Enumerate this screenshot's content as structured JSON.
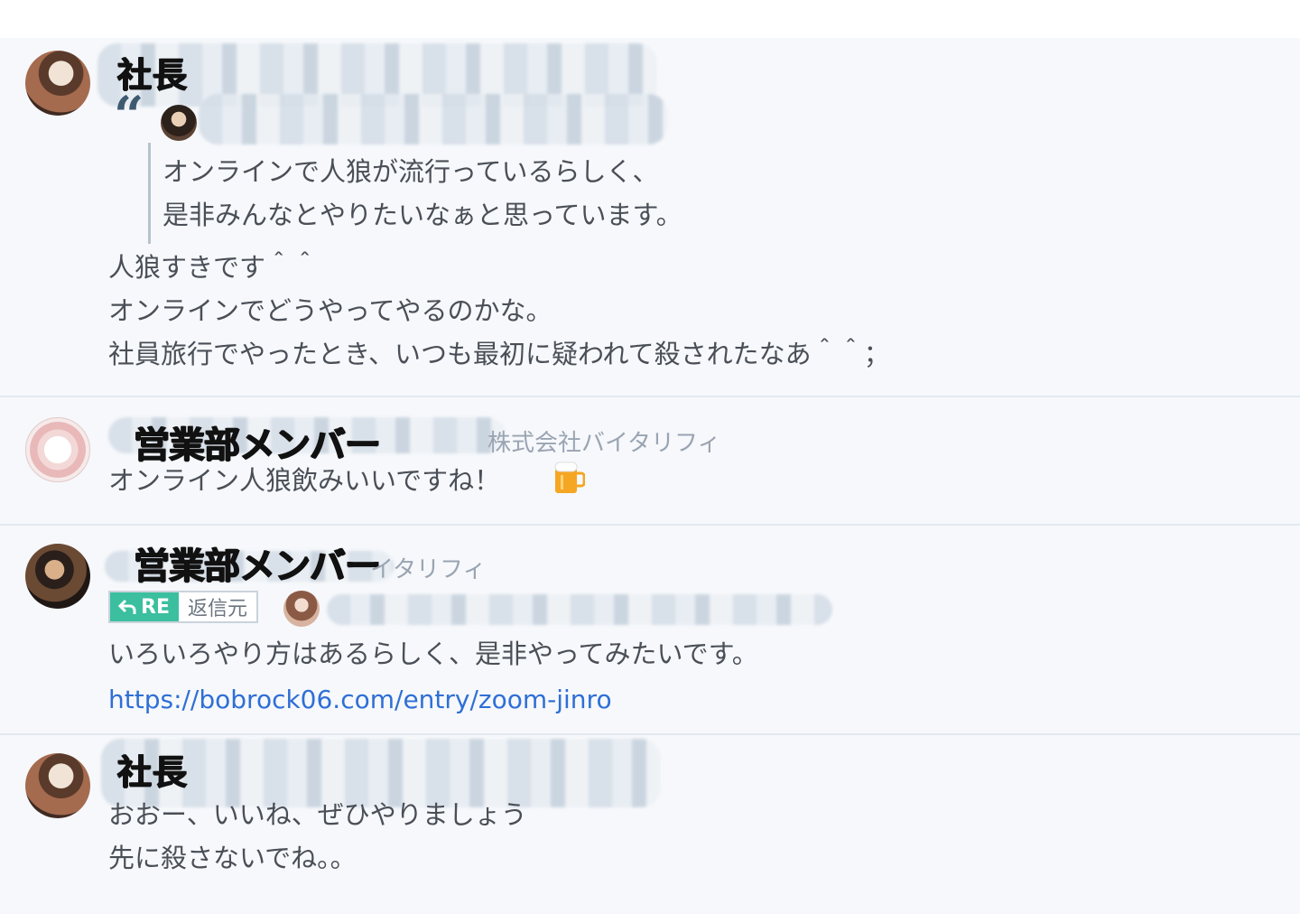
{
  "messages": [
    {
      "author": "社長",
      "quote_lines": [
        "オンラインで人狼が流行っているらしく、",
        "是非みんなとやりたいなぁと思っています。"
      ],
      "lines": [
        "人狼すきです＾＾",
        "オンラインでどうやってやるのかな。",
        "社員旅行でやったとき、いつも最初に疑われて殺されたなあ＾＾；"
      ]
    },
    {
      "author": "営業部メンバー",
      "company": "株式会社バイタリフィ",
      "lines": [
        "オンライン人狼飲みいいですね！"
      ],
      "emoji": "beer-mug"
    },
    {
      "author": "営業部メンバー",
      "company": "イタリフィ",
      "reply_badge": {
        "re": "RE",
        "label": "返信元"
      },
      "lines": [
        "いろいろやり方はあるらしく、是非やってみたいです。"
      ],
      "link": "https://bobrock06.com/entry/zoom-jinro"
    },
    {
      "author": "社長",
      "lines": [
        "おおー、いいね、ぜひやりましょう",
        "先に殺さないでね。。"
      ]
    }
  ],
  "colors": {
    "background": "#f6f8fb",
    "text": "#4a4f57",
    "link": "#2f6fd6",
    "re_badge": "#3bbf9f",
    "quote_mark": "#3e5a70"
  }
}
